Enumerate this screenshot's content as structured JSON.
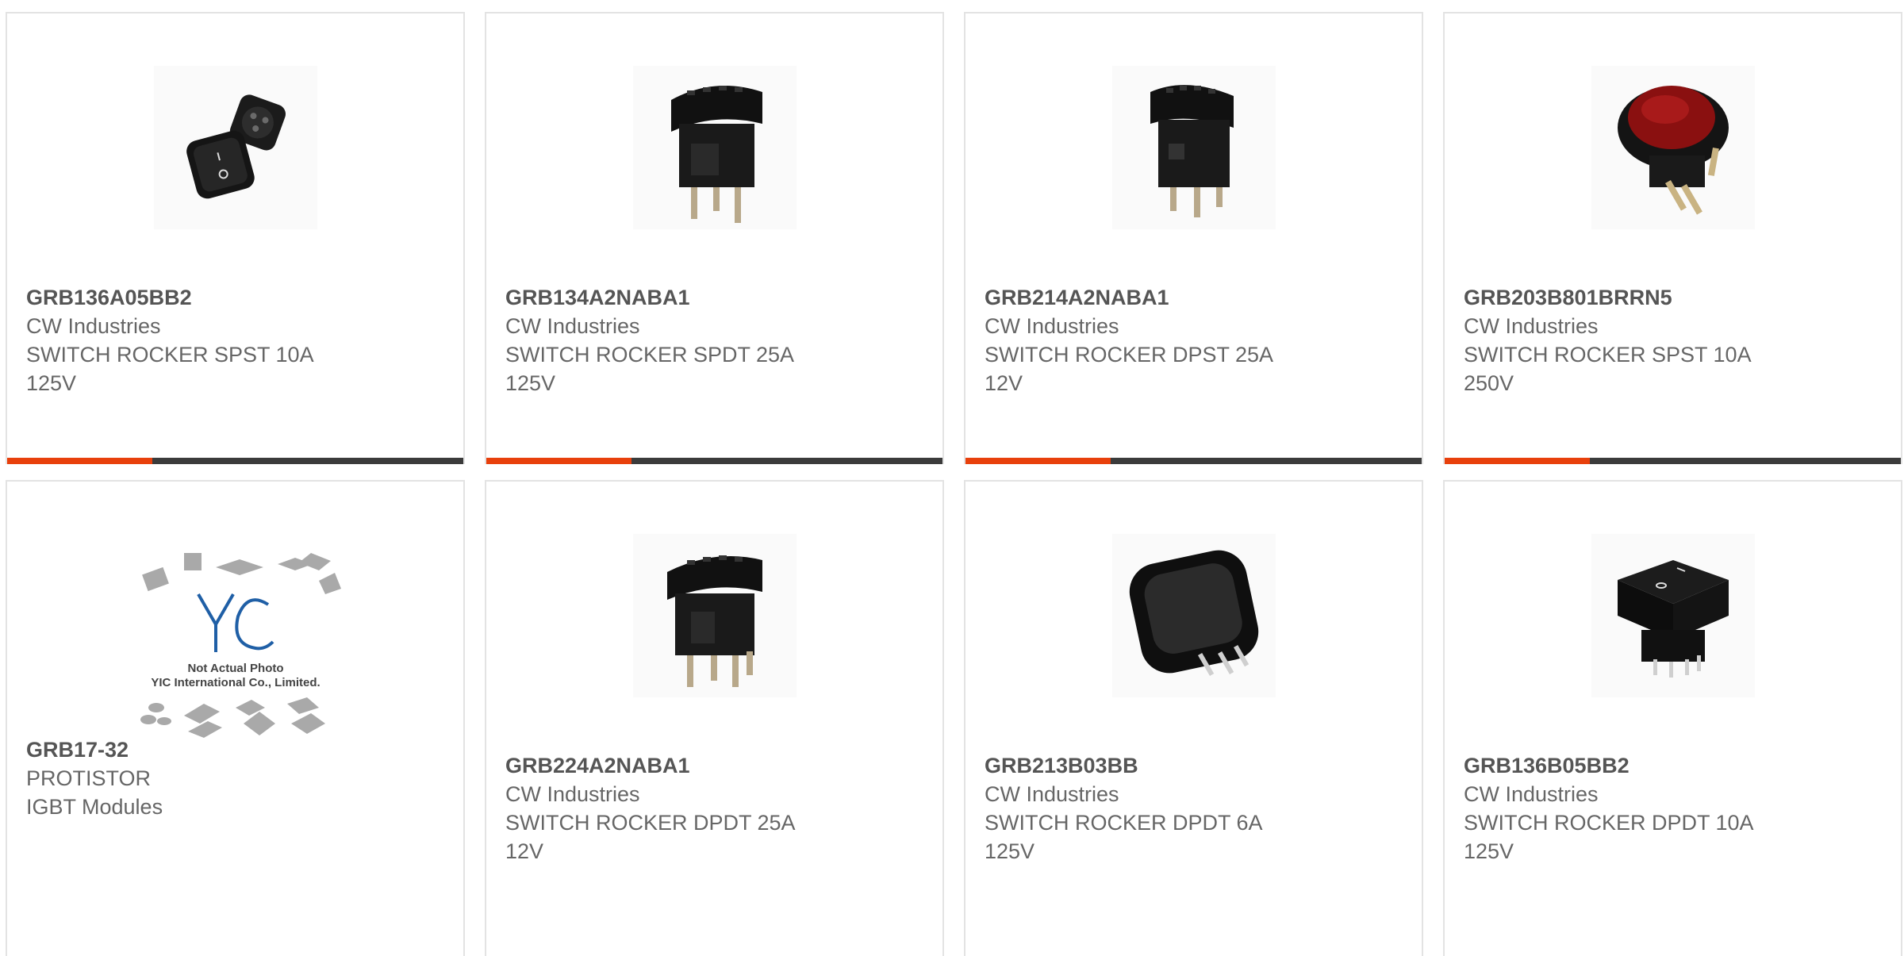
{
  "products": [
    {
      "part_number": "GRB136A05BB2",
      "manufacturer": "CW Industries",
      "desc_line1": "SWITCH ROCKER SPST 10A",
      "desc_line2": "125V",
      "image_icon": "square-rocker-switch-pair-icon"
    },
    {
      "part_number": "GRB134A2NABA1",
      "manufacturer": "CW Industries",
      "desc_line1": "SWITCH ROCKER SPDT 25A",
      "desc_line2": "125V",
      "image_icon": "sealed-rocker-switch-icon"
    },
    {
      "part_number": "GRB214A2NABA1",
      "manufacturer": "CW Industries",
      "desc_line1": "SWITCH ROCKER DPST 25A",
      "desc_line2": "12V",
      "image_icon": "sealed-rocker-switch-icon"
    },
    {
      "part_number": "GRB203B801BRRN5",
      "manufacturer": "CW Industries",
      "desc_line1": "SWITCH ROCKER SPST 10A",
      "desc_line2": "250V",
      "image_icon": "round-red-rocker-switch-icon"
    },
    {
      "part_number": "GRB17-32",
      "manufacturer": "PROTISTOR",
      "desc_line1": "IGBT Modules",
      "desc_line2": "",
      "image_icon": "placeholder-chips-icon",
      "placeholder_line1": "Not Actual Photo",
      "placeholder_line2": "YIC International Co., Limited."
    },
    {
      "part_number": "GRB224A2NABA1",
      "manufacturer": "CW Industries",
      "desc_line1": "SWITCH ROCKER DPDT 25A",
      "desc_line2": "12V",
      "image_icon": "sealed-rocker-switch-icon"
    },
    {
      "part_number": "GRB213B03BB",
      "manufacturer": "CW Industries",
      "desc_line1": "SWITCH ROCKER DPDT 6A",
      "desc_line2": "125V",
      "image_icon": "square-black-rocker-switch-icon"
    },
    {
      "part_number": "GRB136B05BB2",
      "manufacturer": "CW Industries",
      "desc_line1": "SWITCH ROCKER DPDT 10A",
      "desc_line2": "125V",
      "image_icon": "square-rocker-switch-icon"
    }
  ],
  "colors": {
    "accent": "#e8400c",
    "bar_dark": "#3b3b3b",
    "card_border": "#e3e3e3",
    "text": "#666666",
    "placeholder_blue": "#1f5fa6"
  }
}
